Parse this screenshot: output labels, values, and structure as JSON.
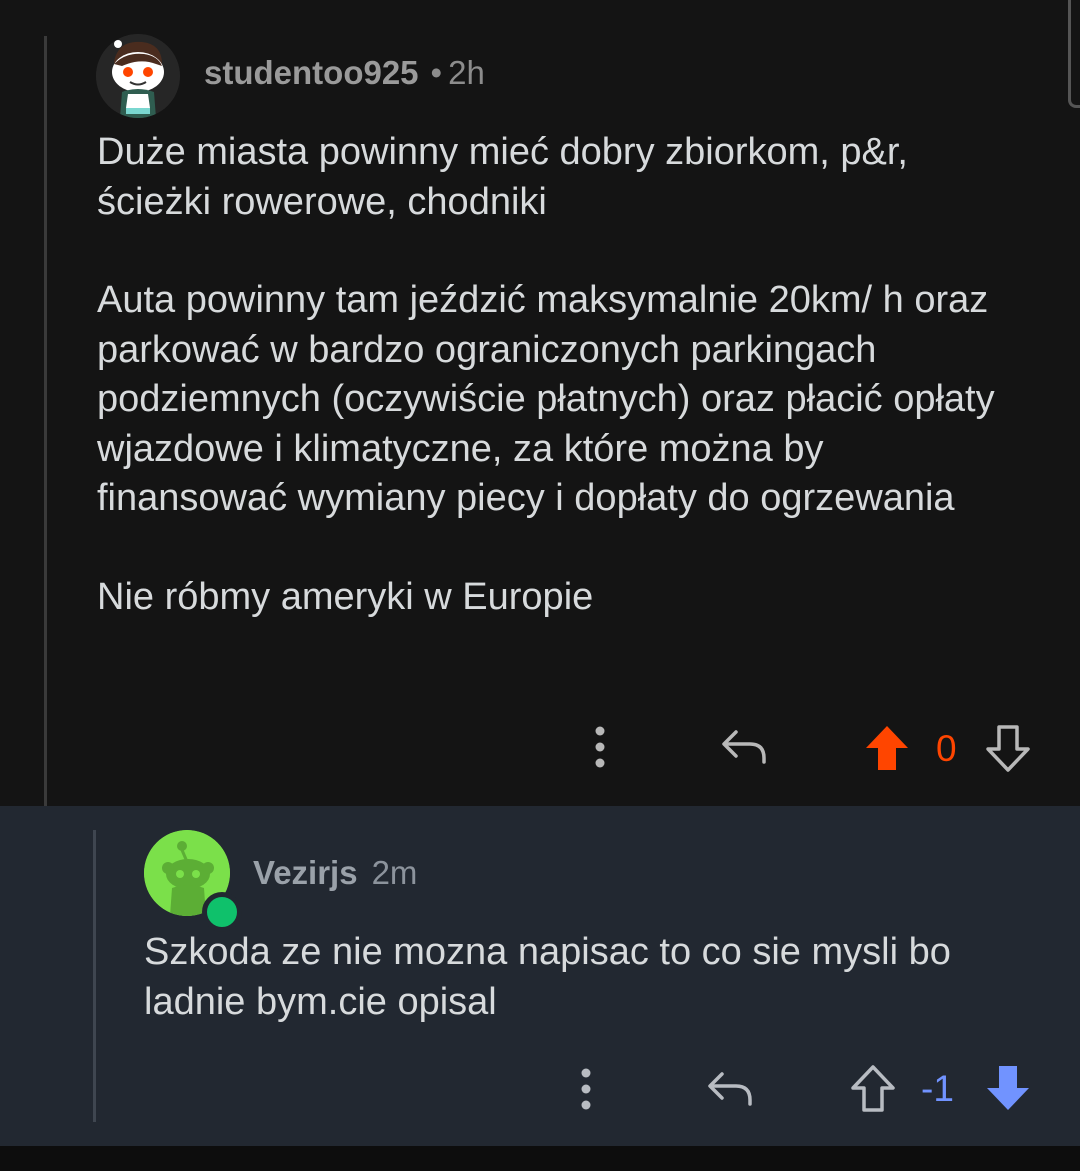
{
  "comment1": {
    "author": "studentoo925",
    "separator": "•",
    "time": "2h",
    "paragraphs": [
      "Duże miasta powinny mieć dobry zbiorkom, p&r, ścieżki rowerowe, chodniki",
      "Auta powinny tam jeździć maksymalnie 20km/ h oraz parkować w bardzo ograniczonych parkingach podziemnych (oczywiście płatnych) oraz płacić opłaty wjazdowe i klimatyczne, za które można by finansować wymiany piecy i dopłaty do ogrzewania",
      "Nie róbmy ameryki w Europie"
    ],
    "score": "0",
    "vote_state": "upvoted",
    "score_color": "#ff4500"
  },
  "comment2": {
    "author": "Vezirjs",
    "time": "2m",
    "paragraphs": [
      "Szkoda ze nie mozna napisac to co sie mysli bo ladnie bym.cie opisal"
    ],
    "score": "-1",
    "vote_state": "downvoted",
    "score_color": "#7193ff"
  },
  "icons": {
    "more": "more-vertical-icon",
    "reply": "reply-icon",
    "upvote": "upvote-arrow-icon",
    "downvote": "downvote-arrow-icon"
  },
  "colors": {
    "background": "#141414",
    "reply_background": "#222831",
    "upvote": "#ff4500",
    "downvote": "#7193ff",
    "online": "#0fc16b"
  }
}
